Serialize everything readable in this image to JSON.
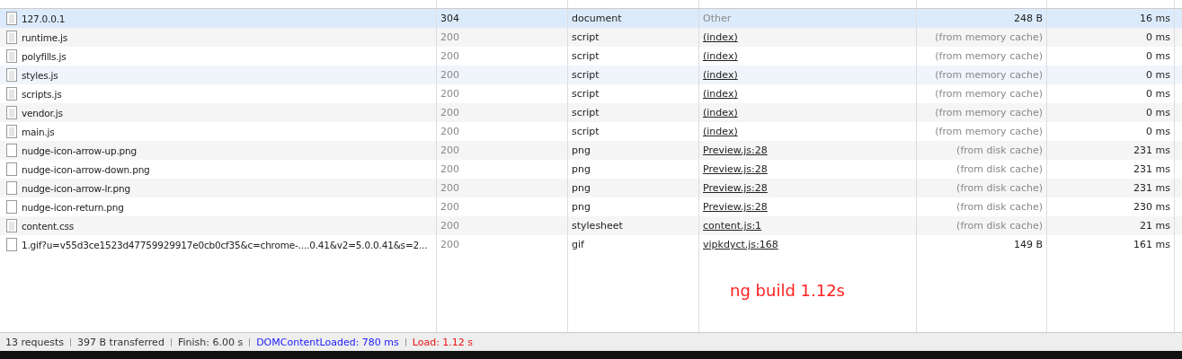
{
  "requests": [
    {
      "name": "127.0.0.1",
      "kind": "document",
      "selected": true,
      "hovered": false,
      "status": "304",
      "cached": false,
      "type": "document",
      "initiator": {
        "text": "Other",
        "link": false
      },
      "size": "248 B",
      "time": "16 ms"
    },
    {
      "name": "runtime.js",
      "kind": "document",
      "selected": false,
      "hovered": false,
      "status": "200",
      "cached": true,
      "type": "script",
      "initiator": {
        "text": "(index)",
        "link": true
      },
      "size": "(from memory cache)",
      "time": "0 ms"
    },
    {
      "name": "polyfills.js",
      "kind": "document",
      "selected": false,
      "hovered": false,
      "status": "200",
      "cached": true,
      "type": "script",
      "initiator": {
        "text": "(index)",
        "link": true
      },
      "size": "(from memory cache)",
      "time": "0 ms"
    },
    {
      "name": "styles.js",
      "kind": "document",
      "selected": false,
      "hovered": true,
      "status": "200",
      "cached": true,
      "type": "script",
      "initiator": {
        "text": "(index)",
        "link": true
      },
      "size": "(from memory cache)",
      "time": "0 ms"
    },
    {
      "name": "scripts.js",
      "kind": "document",
      "selected": false,
      "hovered": false,
      "status": "200",
      "cached": true,
      "type": "script",
      "initiator": {
        "text": "(index)",
        "link": true
      },
      "size": "(from memory cache)",
      "time": "0 ms"
    },
    {
      "name": "vendor.js",
      "kind": "document",
      "selected": false,
      "hovered": false,
      "status": "200",
      "cached": true,
      "type": "script",
      "initiator": {
        "text": "(index)",
        "link": true
      },
      "size": "(from memory cache)",
      "time": "0 ms"
    },
    {
      "name": "main.js",
      "kind": "document",
      "selected": false,
      "hovered": false,
      "status": "200",
      "cached": true,
      "type": "script",
      "initiator": {
        "text": "(index)",
        "link": true
      },
      "size": "(from memory cache)",
      "time": "0 ms"
    },
    {
      "name": "nudge-icon-arrow-up.png",
      "kind": "image",
      "selected": false,
      "hovered": false,
      "status": "200",
      "cached": true,
      "type": "png",
      "initiator": {
        "text": "Preview.js:28",
        "link": true
      },
      "size": "(from disk cache)",
      "time": "231 ms"
    },
    {
      "name": "nudge-icon-arrow-down.png",
      "kind": "image",
      "selected": false,
      "hovered": false,
      "status": "200",
      "cached": true,
      "type": "png",
      "initiator": {
        "text": "Preview.js:28",
        "link": true
      },
      "size": "(from disk cache)",
      "time": "231 ms"
    },
    {
      "name": "nudge-icon-arrow-lr.png",
      "kind": "image",
      "selected": false,
      "hovered": false,
      "status": "200",
      "cached": true,
      "type": "png",
      "initiator": {
        "text": "Preview.js:28",
        "link": true
      },
      "size": "(from disk cache)",
      "time": "231 ms"
    },
    {
      "name": "nudge-icon-return.png",
      "kind": "image",
      "selected": false,
      "hovered": false,
      "status": "200",
      "cached": true,
      "type": "png",
      "initiator": {
        "text": "Preview.js:28",
        "link": true
      },
      "size": "(from disk cache)",
      "time": "230 ms"
    },
    {
      "name": "content.css",
      "kind": "document",
      "selected": false,
      "hovered": false,
      "status": "200",
      "cached": true,
      "type": "stylesheet",
      "initiator": {
        "text": "content.js:1",
        "link": true
      },
      "size": "(from disk cache)",
      "time": "21 ms"
    },
    {
      "name": "1.gif?u=v55d3ce1523d47759929917e0cb0cf35&c=chrome-....0.41&v2=5.0.0.41&s=2...",
      "kind": "image",
      "selected": false,
      "hovered": false,
      "status": "200",
      "cached": true,
      "type": "gif",
      "initiator": {
        "text": "vipkdyct.js:168",
        "link": true
      },
      "size": "149 B",
      "time": "161 ms"
    }
  ],
  "annotation": "ng build 1.12s",
  "status_bar": [
    {
      "text": "13 requests",
      "kind": "plain"
    },
    {
      "text": "397 B transferred",
      "kind": "plain"
    },
    {
      "text": "Finish: 6.00 s",
      "kind": "plain"
    },
    {
      "text": "DOMContentLoaded: 780 ms",
      "kind": "dom"
    },
    {
      "text": "Load: 1.12 s",
      "kind": "load"
    }
  ]
}
